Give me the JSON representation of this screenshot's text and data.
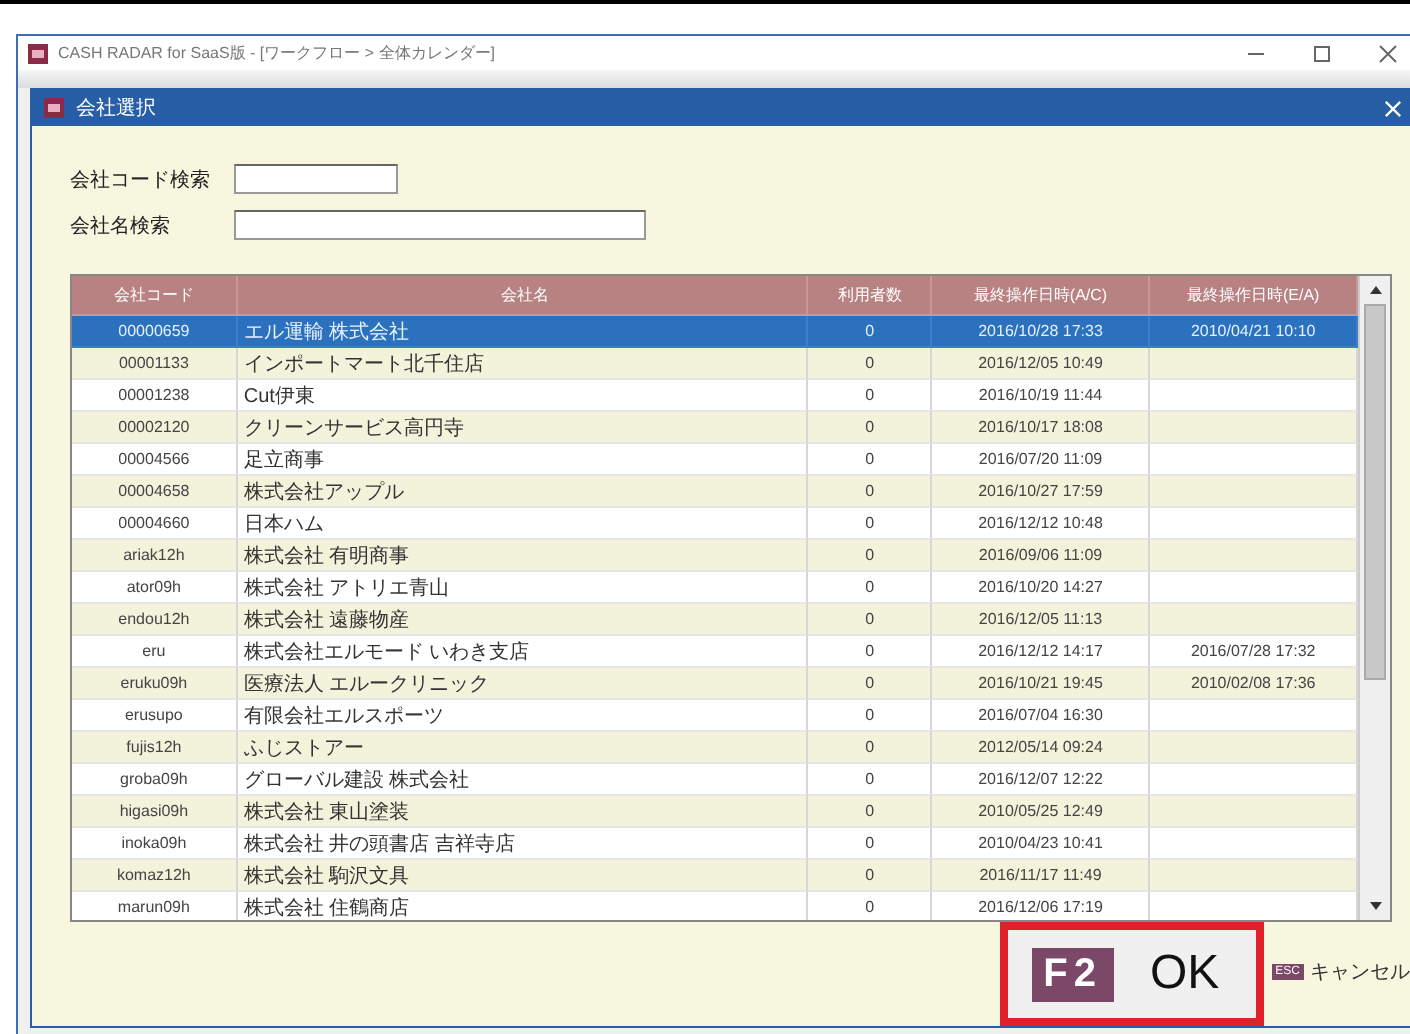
{
  "window": {
    "title": "CASH RADAR for SaaS版 - [ワークフロー > 全体カレンダー]"
  },
  "dialog": {
    "title": "会社選択",
    "search_fields": [
      {
        "label": "会社コード検索",
        "kind": "short"
      },
      {
        "label": "会社名検索",
        "kind": "long"
      }
    ],
    "table": {
      "columns": [
        "会社コード",
        "会社名",
        "利用者数",
        "最終操作日時(A/C)",
        "最終操作日時(E/A)"
      ],
      "rows": [
        {
          "code": "00000659",
          "name": "エル運輸 株式会社",
          "users": "0",
          "last_op_1": "2016/10/28 17:33",
          "last_op_2": "2010/04/21 10:10",
          "selected": true
        },
        {
          "code": "00001133",
          "name": "インポートマート北千住店",
          "users": "0",
          "last_op_1": "2016/12/05 10:49",
          "selected": false
        },
        {
          "code": "00001238",
          "name": "Cut伊東",
          "users": "0",
          "last_op_1": "2016/10/19 11:44",
          "selected": false
        },
        {
          "code": "00002120",
          "name": "クリーンサービス高円寺",
          "users": "0",
          "last_op_1": "2016/10/17 18:08",
          "selected": false
        },
        {
          "code": "00004566",
          "name": "足立商事",
          "users": "0",
          "last_op_1": "2016/07/20 11:09",
          "selected": false
        },
        {
          "code": "00004658",
          "name": "株式会社アップル",
          "users": "0",
          "last_op_1": "2016/10/27 17:59",
          "selected": false
        },
        {
          "code": "00004660",
          "name": "日本ハム",
          "users": "0",
          "last_op_1": "2016/12/12 10:48",
          "selected": false
        },
        {
          "code": "ariak12h",
          "name": "株式会社 有明商事",
          "users": "0",
          "last_op_1": "2016/09/06 11:09",
          "selected": false
        },
        {
          "code": "ator09h",
          "name": "株式会社 アトリエ青山",
          "users": "0",
          "last_op_1": "2016/10/20 14:27",
          "selected": false
        },
        {
          "code": "endou12h",
          "name": "株式会社 遠藤物産",
          "users": "0",
          "last_op_1": "2016/12/05 11:13",
          "selected": false
        },
        {
          "code": "eru",
          "name": "株式会社エルモード いわき支店",
          "users": "0",
          "last_op_1": "2016/12/12 14:17",
          "last_op_2": "2016/07/28 17:32",
          "selected": false
        },
        {
          "code": "eruku09h",
          "name": "医療法人 エルークリニック",
          "users": "0",
          "last_op_1": "2016/10/21 19:45",
          "last_op_2": "2010/02/08 17:36",
          "selected": false
        },
        {
          "code": "erusupo",
          "name": "有限会社エルスポーツ",
          "users": "0",
          "last_op_1": "2016/07/04 16:30",
          "selected": false
        },
        {
          "code": "fujis12h",
          "name": "ふじストアー",
          "users": "0",
          "last_op_1": "2012/05/14 09:24",
          "selected": false
        },
        {
          "code": "groba09h",
          "name": "グローバル建設 株式会社",
          "users": "0",
          "last_op_1": "2016/12/07 12:22",
          "selected": false
        },
        {
          "code": "higasi09h",
          "name": "株式会社 東山塗装",
          "users": "0",
          "last_op_1": "2010/05/25 12:49",
          "selected": false
        },
        {
          "code": "inoka09h",
          "name": "株式会社 井の頭書店 吉祥寺店",
          "users": "0",
          "last_op_1": "2010/04/23 10:41",
          "selected": false
        },
        {
          "code": "komaz12h",
          "name": "株式会社 駒沢文具",
          "users": "0",
          "last_op_1": "2016/11/17 11:49",
          "selected": false
        },
        {
          "code": "marun09h",
          "name": "株式会社 住鶴商店",
          "users": "0",
          "last_op_1": "2016/12/06 17:19",
          "selected": false
        }
      ]
    },
    "buttons": [
      {
        "kind": "ok",
        "key": "F2",
        "label": "OK",
        "highlighted": true
      },
      {
        "kind": "cancel",
        "key": "ESC",
        "label": "キャンセル",
        "highlighted": false
      }
    ]
  }
}
